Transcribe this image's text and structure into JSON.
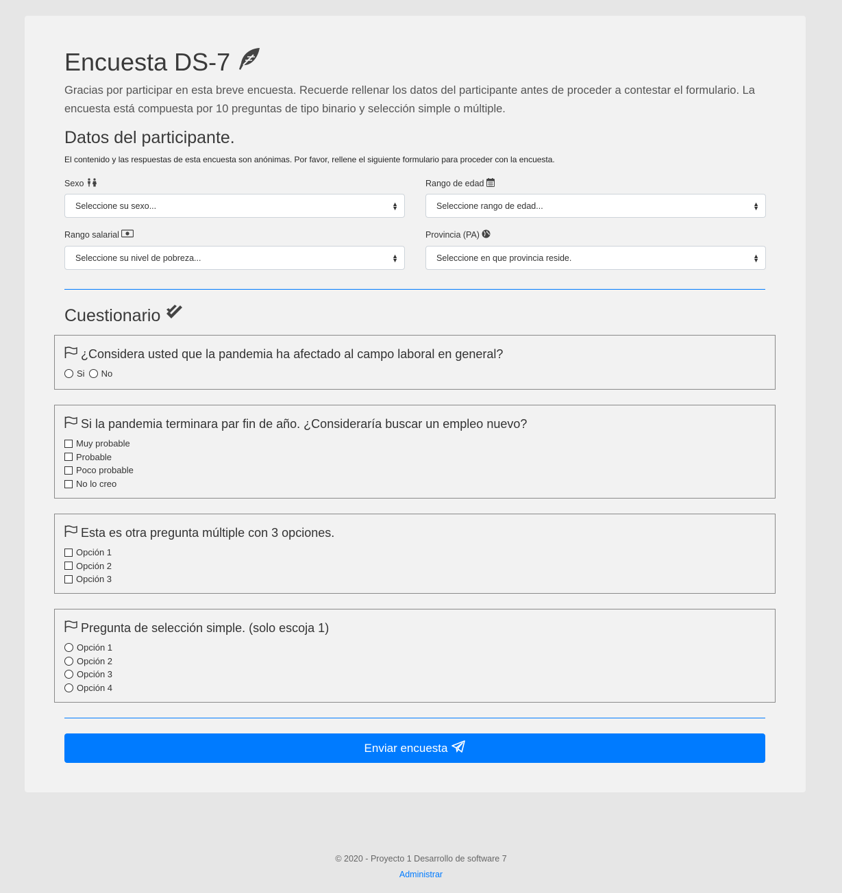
{
  "header": {
    "title": "Encuesta DS-7",
    "lead": "Gracias por participar en esta breve encuesta. Recuerde rellenar los datos del participante antes de proceder a contestar el formulario. La encuesta está compuesta por 10 preguntas de tipo binario y selección simple o múltiple."
  },
  "participant": {
    "heading": "Datos del participante.",
    "note": "El contenido y las respuestas de esta encuesta son anónimas. Por favor, rellene el siguiente formulario para proceder con la encuesta.",
    "sexo": {
      "label": "Sexo",
      "value": "Seleccione su sexo..."
    },
    "edad": {
      "label": "Rango de edad",
      "value": "Seleccione rango de edad..."
    },
    "salario": {
      "label": "Rango salarial",
      "value": "Seleccione su nivel de pobreza..."
    },
    "provincia": {
      "label": "Provincia (PA)",
      "value": "Seleccione en que provincia reside."
    }
  },
  "questionnaire": {
    "heading": "Cuestionario",
    "questions": [
      {
        "text": "¿Considera usted que la pandemia ha afectado al campo laboral en general?",
        "type": "radio",
        "options": [
          "Si",
          "No"
        ]
      },
      {
        "text": "Si la pandemia terminara par fin de año. ¿Consideraría buscar un empleo nuevo?",
        "type": "checkbox",
        "options": [
          "Muy probable",
          "Probable",
          "Poco probable",
          "No lo creo"
        ]
      },
      {
        "text": "Esta es otra pregunta múltiple con 3 opciones.",
        "type": "checkbox",
        "options": [
          "Opción 1",
          "Opción 2",
          "Opción 3"
        ]
      },
      {
        "text": "Pregunta de selección simple. (solo escoja 1)",
        "type": "radio",
        "options": [
          "Opción 1",
          "Opción 2",
          "Opción 3",
          "Opción 4"
        ]
      }
    ]
  },
  "submit": {
    "label": "Enviar encuesta"
  },
  "footer": {
    "copyright": "© 2020 - Proyecto 1 Desarrollo de software 7",
    "admin_link": "Administrar"
  },
  "colors": {
    "accent": "#007bff",
    "card": "#f2f2f2",
    "background": "#e6e6e6"
  },
  "icons": [
    "feather-icon",
    "restroom-icon",
    "calendar-icon",
    "money-bill-icon",
    "globe-icon",
    "double-check-icon",
    "flag-icon",
    "paper-plane-icon"
  ]
}
